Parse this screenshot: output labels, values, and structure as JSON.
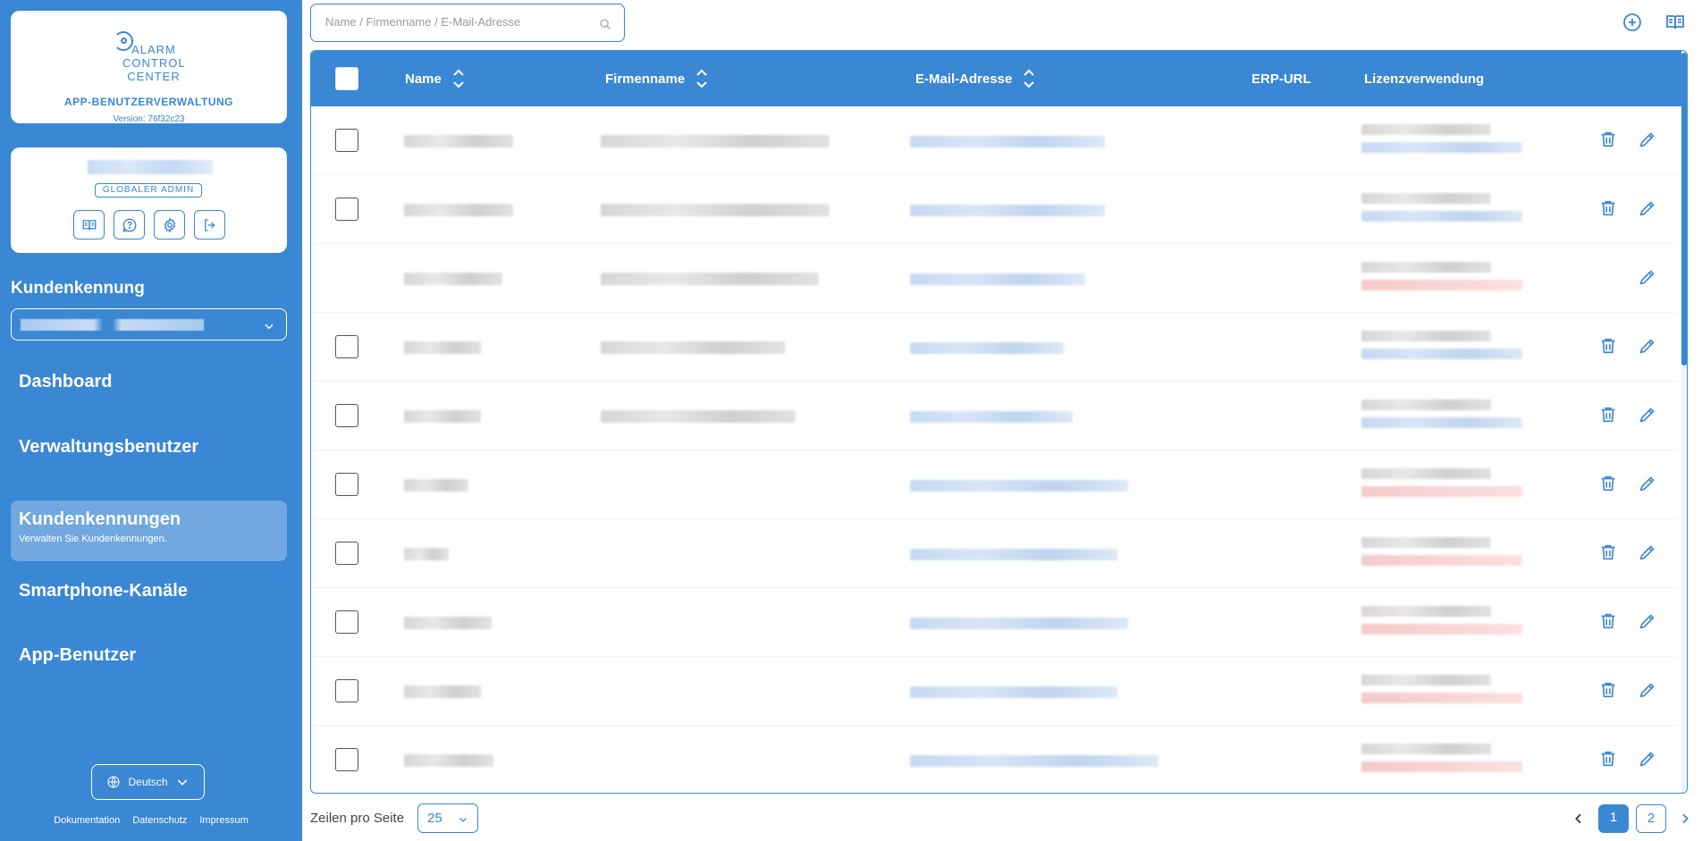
{
  "brand": {
    "logo_text": "ALARM CONTROL CENTER",
    "title": "APP-BENUTZERVERWALTUNG",
    "version": "Version: 76f32c23"
  },
  "user": {
    "role": "GLOBALER ADMIN"
  },
  "sidebar": {
    "kunden_label": "Kundenkennung",
    "nav": [
      {
        "label": "Dashboard",
        "sub": ""
      },
      {
        "label": "Verwaltungsbenutzer",
        "sub": ""
      },
      {
        "label": "Kundenkennungen",
        "sub": "Verwalten Sie Kundenkennungen."
      },
      {
        "label": "Smartphone-Kanäle",
        "sub": ""
      },
      {
        "label": "App-Benutzer",
        "sub": ""
      }
    ],
    "language": "Deutsch",
    "footer": [
      "Dokumentation",
      "Datenschutz",
      "Impressum"
    ]
  },
  "search": {
    "placeholder": "Name / Firmenname / E-Mail-Adresse"
  },
  "table": {
    "columns": [
      "Name",
      "Firmenname",
      "E-Mail-Adresse",
      "ERP-URL",
      "Lizenzverwendung"
    ]
  },
  "pagination": {
    "rows_label": "Zeilen pro Seite",
    "rows_value": "25",
    "pages": [
      "1",
      "2"
    ],
    "current_page": "1"
  },
  "colors": {
    "accent": "#3a87d3",
    "sidebar_bg": "#3a87d3",
    "white": "#ffffff"
  }
}
